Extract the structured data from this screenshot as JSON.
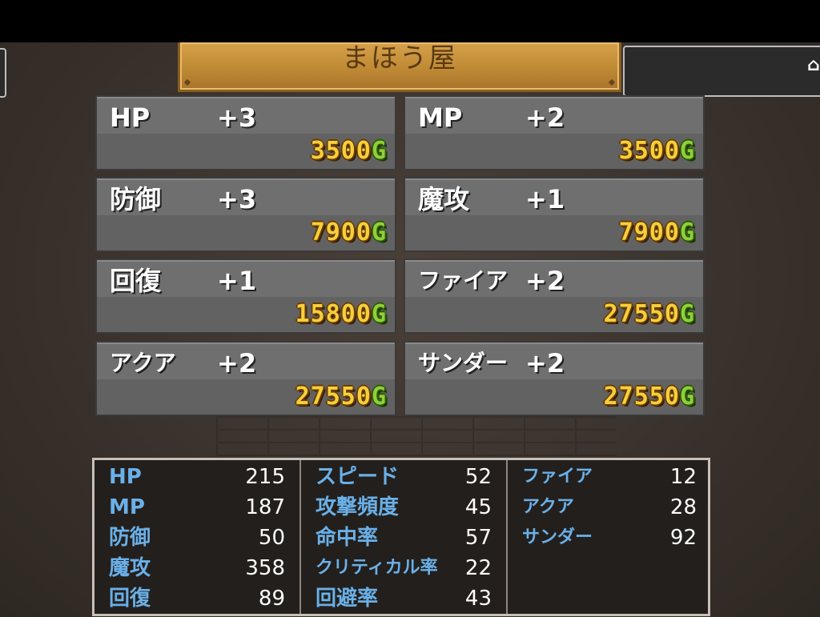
{
  "shop": {
    "title": "まほう屋"
  },
  "items": [
    {
      "name": "HP",
      "plus": "+3",
      "price_num": "3500",
      "price_g": "G"
    },
    {
      "name": "MP",
      "plus": "+2",
      "price_num": "3500",
      "price_g": "G"
    },
    {
      "name": "防御",
      "plus": "+3",
      "price_num": "7900",
      "price_g": "G"
    },
    {
      "name": "魔攻",
      "plus": "+1",
      "price_num": "7900",
      "price_g": "G"
    },
    {
      "name": "回復",
      "plus": "+1",
      "price_num": "15800",
      "price_g": "G"
    },
    {
      "name": "ファイア",
      "plus": "+2",
      "price_num": "27550",
      "price_g": "G"
    },
    {
      "name": "アクア",
      "plus": "+2",
      "price_num": "27550",
      "price_g": "G"
    },
    {
      "name": "サンダー",
      "plus": "+2",
      "price_num": "27550",
      "price_g": "G"
    }
  ],
  "stats": {
    "col1": [
      {
        "label": "HP",
        "value": "215"
      },
      {
        "label": "MP",
        "value": "187"
      },
      {
        "label": "防御",
        "value": "50"
      },
      {
        "label": "魔攻",
        "value": "358"
      },
      {
        "label": "回復",
        "value": "89"
      }
    ],
    "col2": [
      {
        "label": "スピード",
        "value": "52"
      },
      {
        "label": "攻撃頻度",
        "value": "45"
      },
      {
        "label": "命中率",
        "value": "57"
      },
      {
        "label": "クリティカル率",
        "value": "22"
      },
      {
        "label": "回避率",
        "value": "43"
      }
    ],
    "col3": [
      {
        "label": "ファイア",
        "value": "12"
      },
      {
        "label": "アクア",
        "value": "28"
      },
      {
        "label": "サンダー",
        "value": "92"
      }
    ]
  },
  "colors": {
    "stat_label": "#6ab0e8",
    "price_yellow": "#f5d03a",
    "price_green": "#8fd03a",
    "title_plate": "#c08a35"
  },
  "icons": {
    "side_right": "house-icon"
  }
}
